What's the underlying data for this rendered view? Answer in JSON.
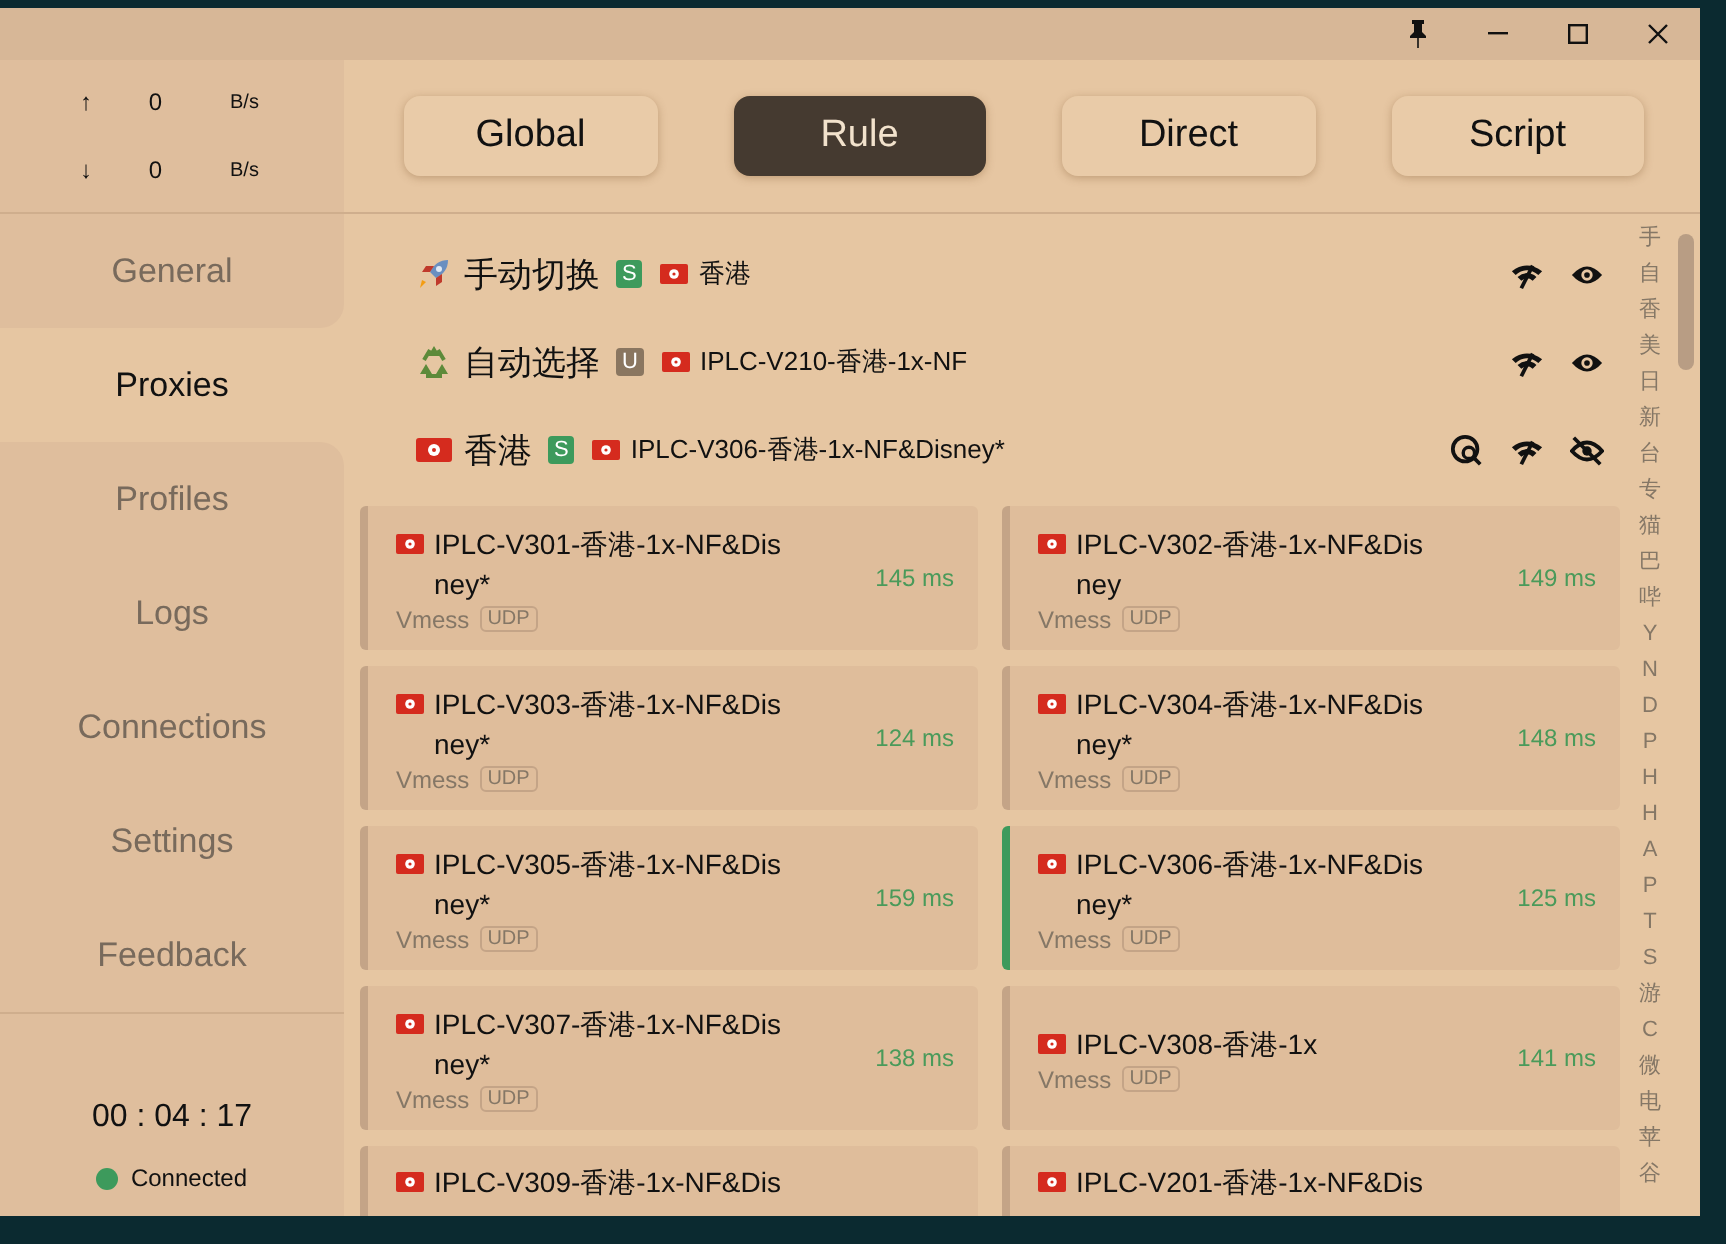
{
  "traffic": [
    {
      "direction": "↑",
      "value": "0",
      "unit": "B/s"
    },
    {
      "direction": "↓",
      "value": "0",
      "unit": "B/s"
    }
  ],
  "nav": [
    {
      "label": "General",
      "selected": false
    },
    {
      "label": "Proxies",
      "selected": true
    },
    {
      "label": "Profiles",
      "selected": false
    },
    {
      "label": "Logs",
      "selected": false
    },
    {
      "label": "Connections",
      "selected": false
    },
    {
      "label": "Settings",
      "selected": false
    },
    {
      "label": "Feedback",
      "selected": false
    }
  ],
  "uptime": "00 : 04 : 17",
  "status": {
    "label": "Connected",
    "connected": true
  },
  "modes": [
    {
      "label": "Global",
      "selected": false
    },
    {
      "label": "Rule",
      "selected": true
    },
    {
      "label": "Direct",
      "selected": false
    },
    {
      "label": "Script",
      "selected": false
    }
  ],
  "groups": [
    {
      "kind": "rocket",
      "name": "手动切换",
      "type": "S",
      "color": "#3d9a5c",
      "now": "香港",
      "expanded": false
    },
    {
      "kind": "recycle",
      "name": "自动选择",
      "type": "U",
      "color": "#8a7660",
      "now": "IPLC-V210-香港-1x-NF",
      "expanded": false
    },
    {
      "kind": "flag",
      "name": "香港",
      "type": "S",
      "color": "#3d9a5c",
      "now": "IPLC-V306-香港-1x-NF&Disney*",
      "expanded": true
    }
  ],
  "proxies": [
    {
      "name": "IPLC-V301-香港-1x-NF&Disney*",
      "delay": "145 ms",
      "protocol": "Vmess",
      "udp": "UDP",
      "selected": false
    },
    {
      "name": "IPLC-V302-香港-1x-NF&Disney",
      "delay": "149 ms",
      "protocol": "Vmess",
      "udp": "UDP",
      "selected": false
    },
    {
      "name": "IPLC-V303-香港-1x-NF&Disney*",
      "delay": "124 ms",
      "protocol": "Vmess",
      "udp": "UDP",
      "selected": false
    },
    {
      "name": "IPLC-V304-香港-1x-NF&Disney*",
      "delay": "148 ms",
      "protocol": "Vmess",
      "udp": "UDP",
      "selected": false
    },
    {
      "name": "IPLC-V305-香港-1x-NF&Disney*",
      "delay": "159 ms",
      "protocol": "Vmess",
      "udp": "UDP",
      "selected": false
    },
    {
      "name": "IPLC-V306-香港-1x-NF&Disney*",
      "delay": "125 ms",
      "protocol": "Vmess",
      "udp": "UDP",
      "selected": true
    },
    {
      "name": "IPLC-V307-香港-1x-NF&Disney*",
      "delay": "138 ms",
      "protocol": "Vmess",
      "udp": "UDP",
      "selected": false
    },
    {
      "name": "IPLC-V308-香港-1x",
      "delay": "141 ms",
      "protocol": "Vmess",
      "udp": "UDP",
      "selected": false
    },
    {
      "name": "IPLC-V309-香港-1x-NF&Dis",
      "selected": false
    },
    {
      "name": "IPLC-V201-香港-1x-NF&Dis",
      "selected": false
    }
  ],
  "index": [
    "手",
    "自",
    "香",
    "美",
    "日",
    "新",
    "台",
    "专",
    "猫",
    "巴",
    "哔",
    "Y",
    "N",
    "D",
    "P",
    "H",
    "H",
    "A",
    "P",
    "T",
    "S",
    "游",
    "C",
    "微",
    "电",
    "苹",
    "谷"
  ]
}
